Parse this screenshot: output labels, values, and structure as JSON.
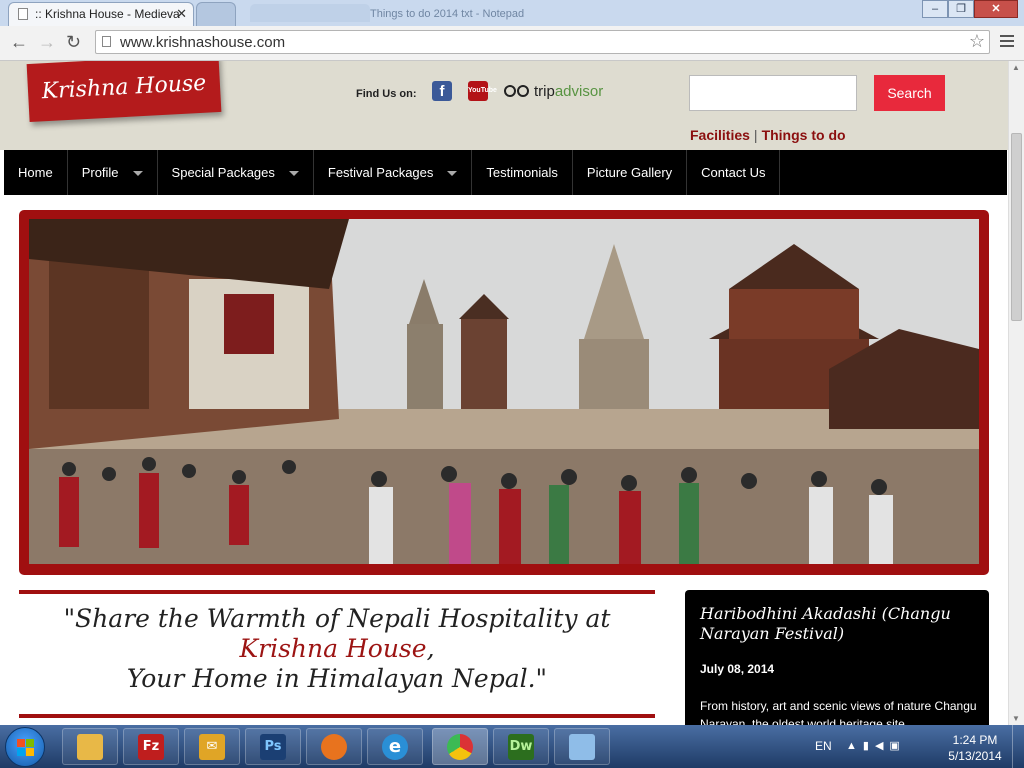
{
  "browser": {
    "tab_title": ":: Krishna House - Medieva",
    "tab_close": "✕",
    "ghost_tab": "Things to do 2014 txt - Notepad",
    "url": "www.krishnashouse.com",
    "win_minimize": "–",
    "win_maximize": "❐",
    "win_close": "✕"
  },
  "header": {
    "logo_text": "Krishna House",
    "find_us_label": "Find Us on:",
    "facebook_glyph": "f",
    "youtube_glyph": "YouTube",
    "tripadvisor_prefix": "trip",
    "tripadvisor_suffix": "advisor",
    "search_placeholder": "",
    "search_button": "Search",
    "links": [
      "Facilities",
      "Things to do"
    ],
    "link_separator": "|"
  },
  "nav": {
    "items": [
      {
        "label": "Home",
        "has_dropdown": false
      },
      {
        "label": "Profile",
        "has_dropdown": true
      },
      {
        "label": "Special Packages",
        "has_dropdown": true
      },
      {
        "label": "Festival Packages",
        "has_dropdown": true
      },
      {
        "label": "Testimonials",
        "has_dropdown": false
      },
      {
        "label": "Picture Gallery",
        "has_dropdown": false
      },
      {
        "label": "Contact Us",
        "has_dropdown": false
      }
    ]
  },
  "quote": {
    "line1": "\"Share the Warmth of Nepali Hospitality at",
    "brand": "Krishna House",
    "comma": ",",
    "line3": "Your Home in Himalayan Nepal.\""
  },
  "event": {
    "title": "Haribodhini Akadashi (Changu Narayan Festival)",
    "date": "July 08, 2014",
    "desc": "From history, art and scenic views of nature Changu Narayan, the oldest world heritage site..."
  },
  "taskbar": {
    "apps": [
      {
        "name": "explorer",
        "glyph": "",
        "color": "#e8b847"
      },
      {
        "name": "filezilla",
        "glyph": "Fz",
        "color": "#bf1e1e"
      },
      {
        "name": "mail",
        "glyph": "✉",
        "color": "#e0a526"
      },
      {
        "name": "photoshop",
        "glyph": "Ps",
        "color": "#1b3f73"
      },
      {
        "name": "firefox",
        "glyph": "",
        "color": "#e8731e"
      },
      {
        "name": "internet-explorer",
        "glyph": "e",
        "color": "#2a8fd6"
      },
      {
        "name": "chrome",
        "glyph": "",
        "color": "#3d9a3d"
      },
      {
        "name": "dreamweaver",
        "glyph": "Dw",
        "color": "#2c6e1e"
      },
      {
        "name": "notepad",
        "glyph": "",
        "color": "#8fbde8"
      }
    ],
    "language": "EN",
    "time": "1:24 PM",
    "date": "5/13/2014"
  }
}
